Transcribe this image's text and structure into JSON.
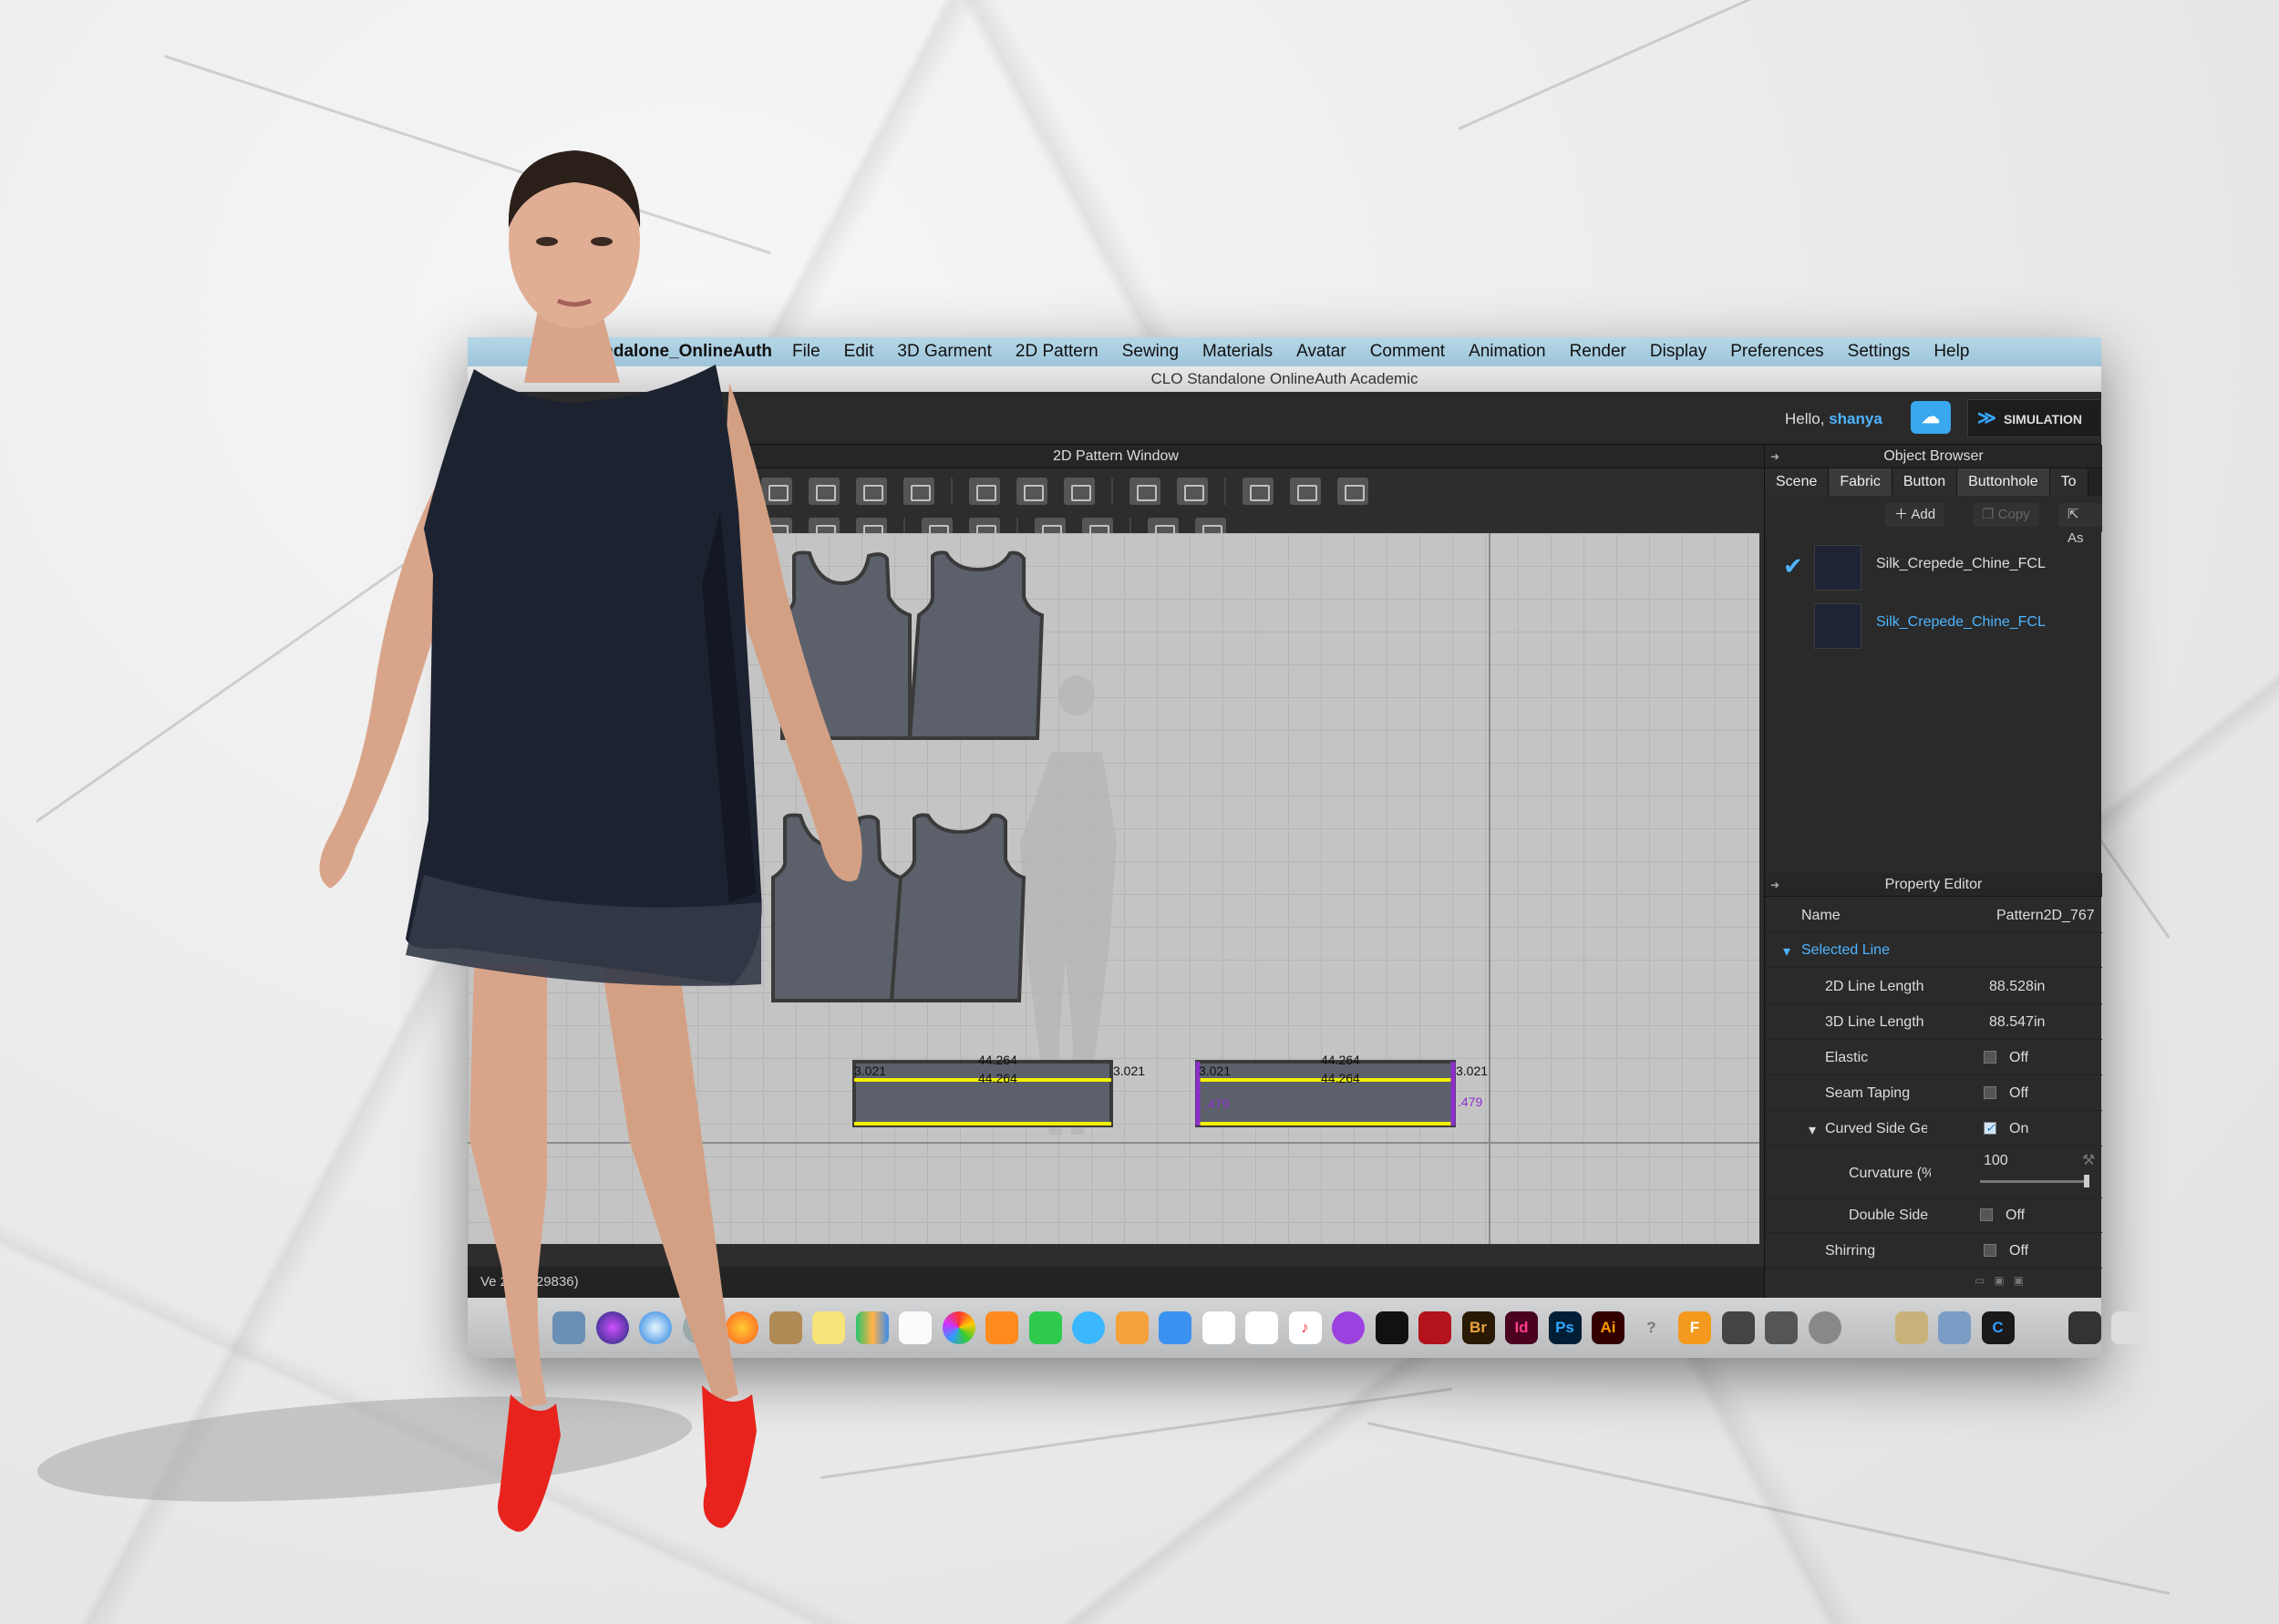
{
  "menubar": {
    "app": "CLO_Standalone_OnlineAuth",
    "items": [
      "File",
      "Edit",
      "3D Garment",
      "2D Pattern",
      "Sewing",
      "Materials",
      "Avatar",
      "Comment",
      "Animation",
      "Render",
      "Display",
      "Preferences",
      "Settings",
      "Help"
    ]
  },
  "window_title": "CLO Standalone OnlineAuth Academic",
  "topbar": {
    "hello": "Hello,",
    "user": "shanya",
    "simulation": "SIMULATION"
  },
  "pattern_window": {
    "title": "2D Pattern Window",
    "measurements": {
      "top_a": "44.264",
      "top_b": "44.264",
      "left": "3.021",
      "right": "3.021",
      "purple": ".479"
    }
  },
  "object_browser": {
    "title": "Object Browser",
    "tabs": [
      "Scene",
      "Fabric",
      "Button",
      "Buttonhole",
      "To"
    ],
    "add": "Add",
    "copy": "Copy",
    "assign": "As",
    "fabrics": [
      {
        "name": "Silk_Crepede_Chine_FCL"
      },
      {
        "name": "Silk_Crepede_Chine_FCL"
      }
    ]
  },
  "property_editor": {
    "title": "Property Editor",
    "name_label": "Name",
    "name_value": "Pattern2D_767",
    "section": "Selected Line",
    "rows": [
      {
        "label": "2D Line Length",
        "value": "88.528in"
      },
      {
        "label": "3D Line Length",
        "value": "88.547in"
      },
      {
        "label": "Elastic",
        "value": "Off"
      },
      {
        "label": "Seam Taping",
        "value": "Off"
      },
      {
        "label": "Curved Side Geometry",
        "value": "On"
      },
      {
        "label": "Curvature (%)",
        "value": "100"
      },
      {
        "label": "Double Side",
        "value": "Off"
      },
      {
        "label": "Shirring",
        "value": "Off"
      }
    ]
  },
  "status": "Ve            204 (r29836)",
  "colors": {
    "accent": "#4fb4ff",
    "pattern": "#5b606b",
    "line_yellow": "#f2f200",
    "selection_purple": "#8b2fc9",
    "dress": "#1c2230",
    "shoes": "#e8231d"
  }
}
